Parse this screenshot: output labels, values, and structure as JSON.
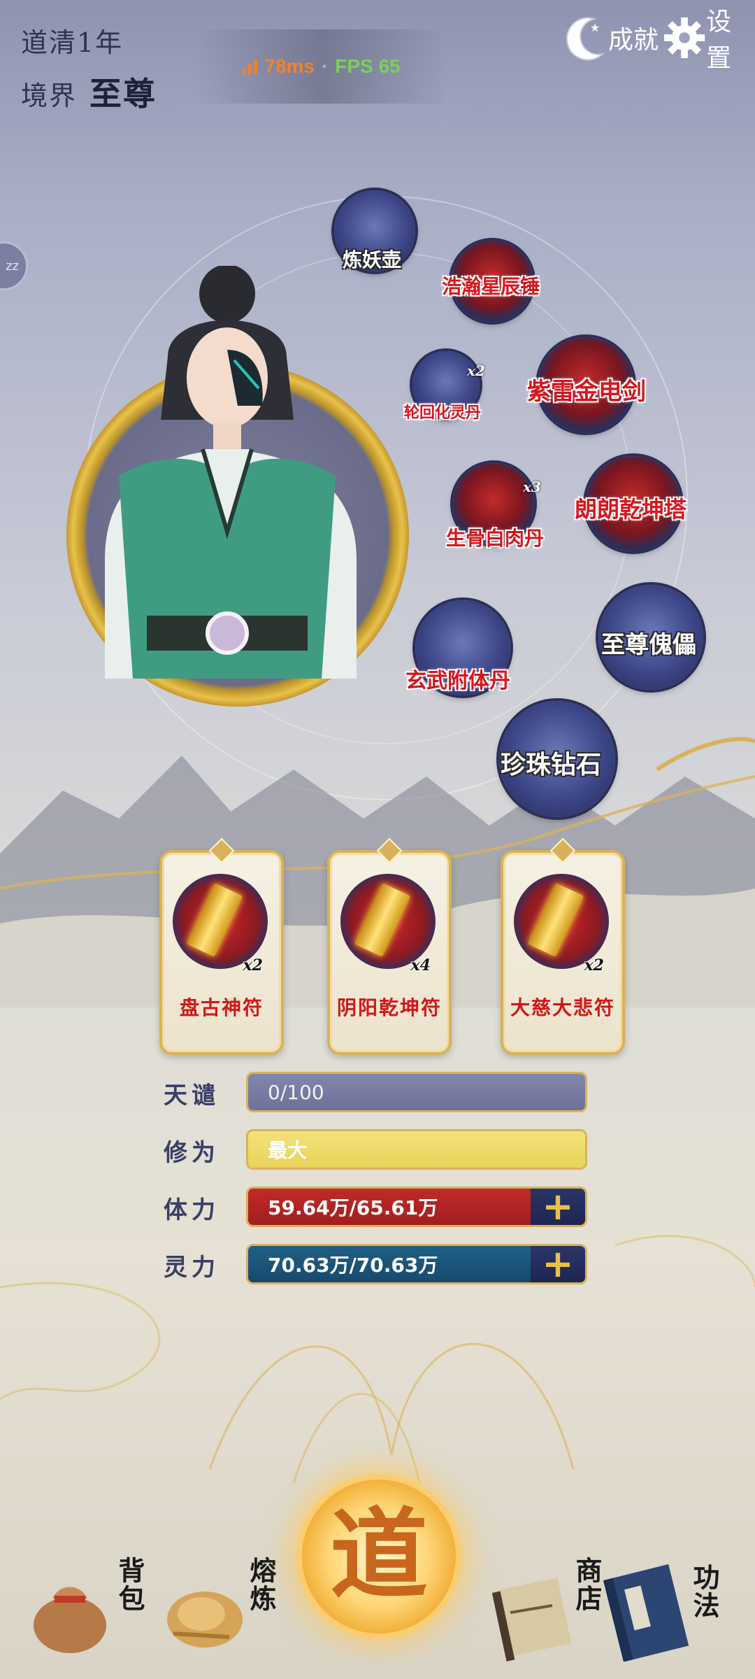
{
  "hud": {
    "daoqing_label": "道清1年",
    "realm_label": "境界",
    "realm_value": "至尊",
    "ping": "78ms",
    "separator": "·",
    "fps": "FPS 65",
    "achievements_label": "成就",
    "settings_label": "设置",
    "side_tab": "zz"
  },
  "items": [
    {
      "name": "炼妖壶",
      "count": ""
    },
    {
      "name": "浩瀚星辰锤",
      "count": ""
    },
    {
      "name": "紫雷金电剑",
      "count": ""
    },
    {
      "name": "轮回化灵丹",
      "count": "x2"
    },
    {
      "name": "朗朗乾坤塔",
      "count": ""
    },
    {
      "name": "生骨白肉丹",
      "count": "x3"
    },
    {
      "name": "至尊傀儡",
      "count": ""
    },
    {
      "name": "玄武附体丹",
      "count": ""
    },
    {
      "name": "珍珠钻石",
      "count": ""
    }
  ],
  "talismans": [
    {
      "name": "盘古神符",
      "count": "x2"
    },
    {
      "name": "阴阳乾坤符",
      "count": "x4"
    },
    {
      "name": "大慈大悲符",
      "count": "x2"
    }
  ],
  "stats": [
    {
      "label": "天谴",
      "value": "0/100"
    },
    {
      "label": "修为",
      "value": "最大"
    },
    {
      "label": "体力",
      "value": "59.64万/65.61万"
    },
    {
      "label": "灵力",
      "value": "70.63万/70.63万"
    }
  ],
  "nav": {
    "bag": "背包",
    "refine": "熔炼",
    "dao": "道",
    "shop": "商店",
    "skills": "功法"
  },
  "colors": {
    "accent_gold": "#d6b45e",
    "label_red": "#d8141c",
    "ping_orange": "#f0822e",
    "fps_green": "#7ad05a"
  }
}
